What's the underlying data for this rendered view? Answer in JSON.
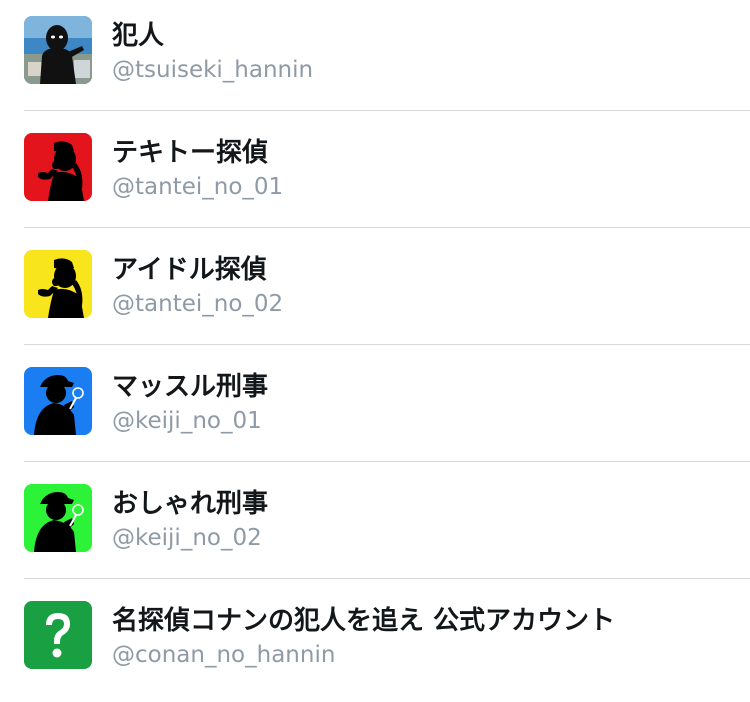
{
  "accounts": [
    {
      "name": "犯人",
      "handle": "@tsuiseki_hannin",
      "avatar_icon": "culprit-photo-icon",
      "avatar_color": "#3d88c4"
    },
    {
      "name": "テキトー探偵",
      "handle": "@tantei_no_01",
      "avatar_icon": "pipe-detective-silhouette-icon",
      "avatar_color": "#e3141b"
    },
    {
      "name": "アイドル探偵",
      "handle": "@tantei_no_02",
      "avatar_icon": "pipe-detective-silhouette-icon",
      "avatar_color": "#f8e51c"
    },
    {
      "name": "マッスル刑事",
      "handle": "@keiji_no_01",
      "avatar_icon": "fedora-detective-silhouette-icon",
      "avatar_color": "#1a7ef2"
    },
    {
      "name": "おしゃれ刑事",
      "handle": "@keiji_no_02",
      "avatar_icon": "fedora-detective-silhouette-icon",
      "avatar_color": "#2cf337"
    },
    {
      "name": "名探偵コナンの犯人を追え 公式アカウント",
      "handle": "@conan_no_hannin",
      "avatar_icon": "question-mark-icon",
      "avatar_color": "#18a042"
    }
  ]
}
